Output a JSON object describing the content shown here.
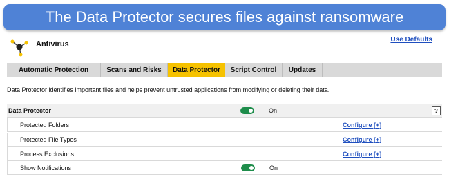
{
  "banner": {
    "text": "The Data Protector secures files against ransomware"
  },
  "header": {
    "title": "Antivirus",
    "use_defaults": "Use Defaults"
  },
  "tabs": [
    {
      "label": "Automatic Protection"
    },
    {
      "label": "Scans and Risks"
    },
    {
      "label": "Data Protector"
    },
    {
      "label": "Script Control"
    },
    {
      "label": "Updates"
    }
  ],
  "active_tab": "Data Protector",
  "description": "Data Protector identifies important files and helps prevent untrusted applications from modifying or deleting their data.",
  "data_protector": {
    "label": "Data Protector",
    "toggle_state": "On",
    "help": "?"
  },
  "settings": [
    {
      "label": "Protected Folders",
      "action": "Configure [+]"
    },
    {
      "label": "Protected File Types",
      "action": "Configure [+]"
    },
    {
      "label": "Process Exclusions",
      "action": "Configure [+]"
    },
    {
      "label": "Show Notifications",
      "toggle_state": "On"
    }
  ],
  "colors": {
    "banner": "#4f82d6",
    "active_tab": "#f6c200",
    "toggle_on": "#1e8d4b",
    "link": "#1f4fbf"
  }
}
